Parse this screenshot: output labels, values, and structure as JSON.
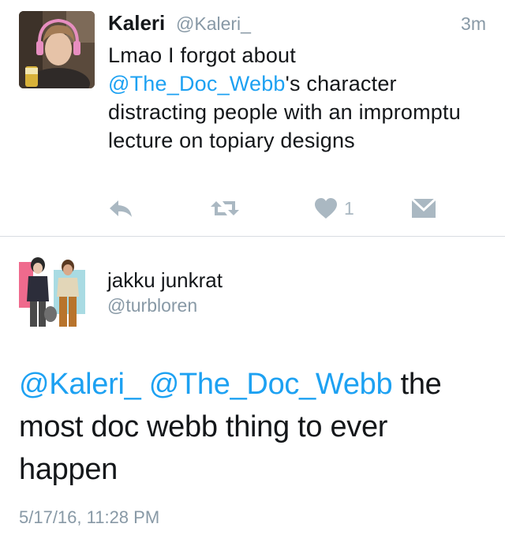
{
  "tweet1": {
    "name": "Kaleri",
    "handle": "@Kaleri_",
    "time": "3m",
    "text_before": "Lmao I forgot about ",
    "mention": "@The_Doc_Webb",
    "text_after": "'s character distracting people with an impromptu lecture on topiary designs",
    "actions": {
      "reply_icon": "reply-icon",
      "retweet_icon": "retweet-icon",
      "like_icon": "heart-icon",
      "like_count": "1",
      "dm_icon": "envelope-icon"
    }
  },
  "tweet2": {
    "name": "jakku junkrat",
    "handle": "@turbloren",
    "mention1": "@Kaleri_",
    "mention2": "@The_Doc_Webb",
    "text_after": " the most doc webb thing to ever happen",
    "timestamp": "5/17/16, 11:28 PM"
  },
  "colors": {
    "link": "#1da1f2",
    "secondary_text": "#8899a6",
    "action_icon": "#aab8c2",
    "divider": "#d8dde2"
  }
}
